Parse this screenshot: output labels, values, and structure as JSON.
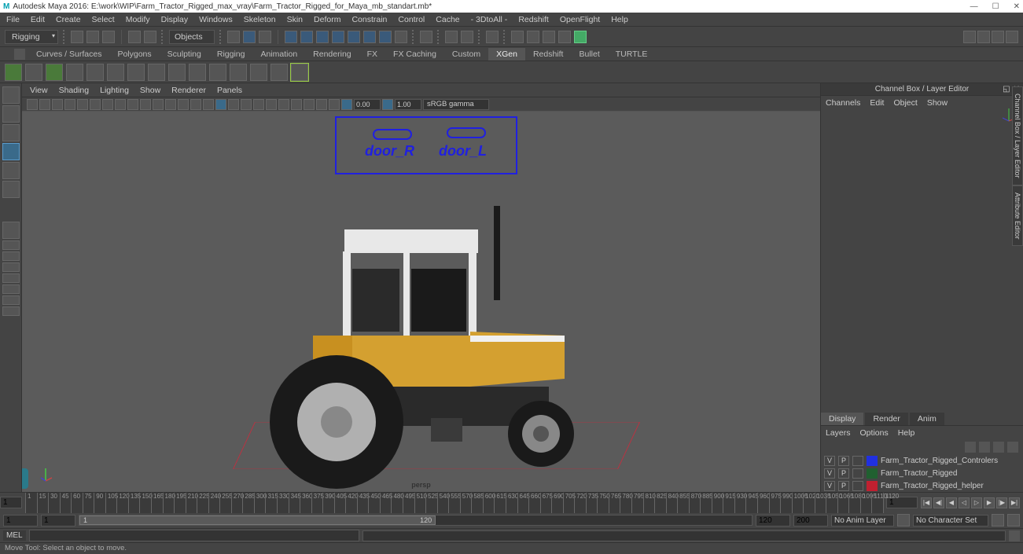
{
  "title": "Autodesk Maya 2016: E:\\work\\WIP\\Farm_Tractor_Rigged_max_vray\\Farm_Tractor_Rigged_for_Maya_mb_standart.mb*",
  "menubar": [
    "File",
    "Edit",
    "Create",
    "Select",
    "Modify",
    "Display",
    "Windows",
    "Skeleton",
    "Skin",
    "Deform",
    "Constrain",
    "Control",
    "Cache",
    "- 3DtoAll -",
    "Redshift",
    "OpenFlight",
    "Help"
  ],
  "workspace": "Rigging",
  "object_mode": "Objects",
  "shelf_tabs": [
    "Curves / Surfaces",
    "Polygons",
    "Sculpting",
    "Rigging",
    "Animation",
    "Rendering",
    "FX",
    "FX Caching",
    "Custom",
    "XGen",
    "Redshift",
    "Bullet",
    "TURTLE"
  ],
  "active_shelf": "XGen",
  "panel_menu": [
    "View",
    "Shading",
    "Lighting",
    "Show",
    "Renderer",
    "Panels"
  ],
  "exposure": "0.00",
  "gamma": "1.00",
  "color_management": "sRGB gamma",
  "persp_label": "persp",
  "rig_labels": {
    "left": "door_R",
    "right": "door_L"
  },
  "channel_box": {
    "title": "Channel Box / Layer Editor",
    "menus": [
      "Channels",
      "Edit",
      "Object",
      "Show"
    ],
    "layer_tabs": [
      "Display",
      "Render",
      "Anim"
    ],
    "active_layer_tab": "Display",
    "layers_menu": [
      "Layers",
      "Options",
      "Help"
    ],
    "layers": [
      {
        "v": "V",
        "p": "P",
        "color": "#2030e0",
        "name": "Farm_Tractor_Rigged_Controlers"
      },
      {
        "v": "V",
        "p": "P",
        "color": "#206030",
        "name": "Farm_Tractor_Rigged"
      },
      {
        "v": "V",
        "p": "P",
        "color": "#c02030",
        "name": "Farm_Tractor_Rigged_helper"
      }
    ]
  },
  "side_tabs": [
    "Channel Box / Layer Editor",
    "Attribute Editor"
  ],
  "timeline": {
    "ticks": [
      "1",
      "15",
      "30",
      "45",
      "60",
      "75",
      "90",
      "105",
      "120",
      "135",
      "150",
      "165",
      "180",
      "195",
      "210",
      "225",
      "240",
      "255",
      "270",
      "285",
      "300",
      "315",
      "330",
      "345",
      "360",
      "375",
      "390",
      "405",
      "420",
      "435",
      "450",
      "465",
      "480",
      "495",
      "510",
      "525",
      "540",
      "555",
      "570",
      "585",
      "600",
      "615",
      "630",
      "645",
      "660",
      "675",
      "690",
      "705",
      "720",
      "735",
      "750",
      "765",
      "780",
      "795",
      "810",
      "825",
      "840",
      "855",
      "870",
      "885",
      "900",
      "915",
      "930",
      "945",
      "960",
      "975",
      "990",
      "1005",
      "1020",
      "1035",
      "1050",
      "1065",
      "1080",
      "1095",
      "1110",
      "1120"
    ],
    "current": "1",
    "range_start": "1",
    "range_end": "120",
    "total_start": "1",
    "total_end": "120",
    "anim_start": "120",
    "anim_end": "200",
    "anim_layer": "No Anim Layer",
    "char_set": "No Character Set"
  },
  "cmd": {
    "lang": "MEL"
  },
  "help": "Move Tool: Select an object to move."
}
